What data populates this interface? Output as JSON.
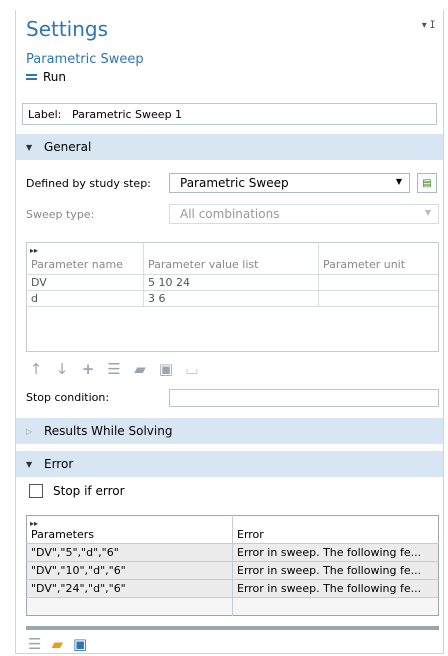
{
  "header": {
    "title": "Settings",
    "subtitle": "Parametric Sweep",
    "run_label": "Run",
    "pin_glyph": "▾ ⵊ"
  },
  "label_field": {
    "label": "Label:",
    "value": "Parametric Sweep 1"
  },
  "general": {
    "section_title": "General",
    "study_step_label": "Defined by study step:",
    "study_step_value": "Parametric Sweep",
    "sweep_type_label": "Sweep type:",
    "sweep_type_value": "All combinations",
    "table": {
      "columns": [
        "Parameter name",
        "Parameter value list",
        "Parameter unit"
      ],
      "rows": [
        [
          "DV",
          "5 10 24",
          ""
        ],
        [
          "d",
          "3 6",
          ""
        ]
      ]
    },
    "toolbar_icons": [
      "move-up-icon",
      "move-down-icon",
      "add-icon",
      "clear-table-icon",
      "open-file-icon",
      "save-icon",
      "load-from-file-icon"
    ],
    "stop_condition_label": "Stop condition:",
    "stop_condition_value": ""
  },
  "results_section": {
    "title": "Results While Solving"
  },
  "error": {
    "section_title": "Error",
    "stop_if_error_label": "Stop if error",
    "stop_if_error_checked": false,
    "table": {
      "columns": [
        "Parameters",
        "Error"
      ],
      "rows": [
        [
          "\"DV\",\"5\",\"d\",\"6\"",
          "Error in sweep. The following fe..."
        ],
        [
          "\"DV\",\"10\",\"d\",\"6\"",
          "Error in sweep. The following fe..."
        ],
        [
          "\"DV\",\"24\",\"d\",\"6\"",
          "Error in sweep. The following fe..."
        ]
      ]
    },
    "bottom_icons": [
      "clear-table-icon",
      "open-file-icon",
      "save-icon"
    ]
  },
  "colors": {
    "accent": "#2e75b6",
    "section_bg": "#d8e6f3"
  }
}
